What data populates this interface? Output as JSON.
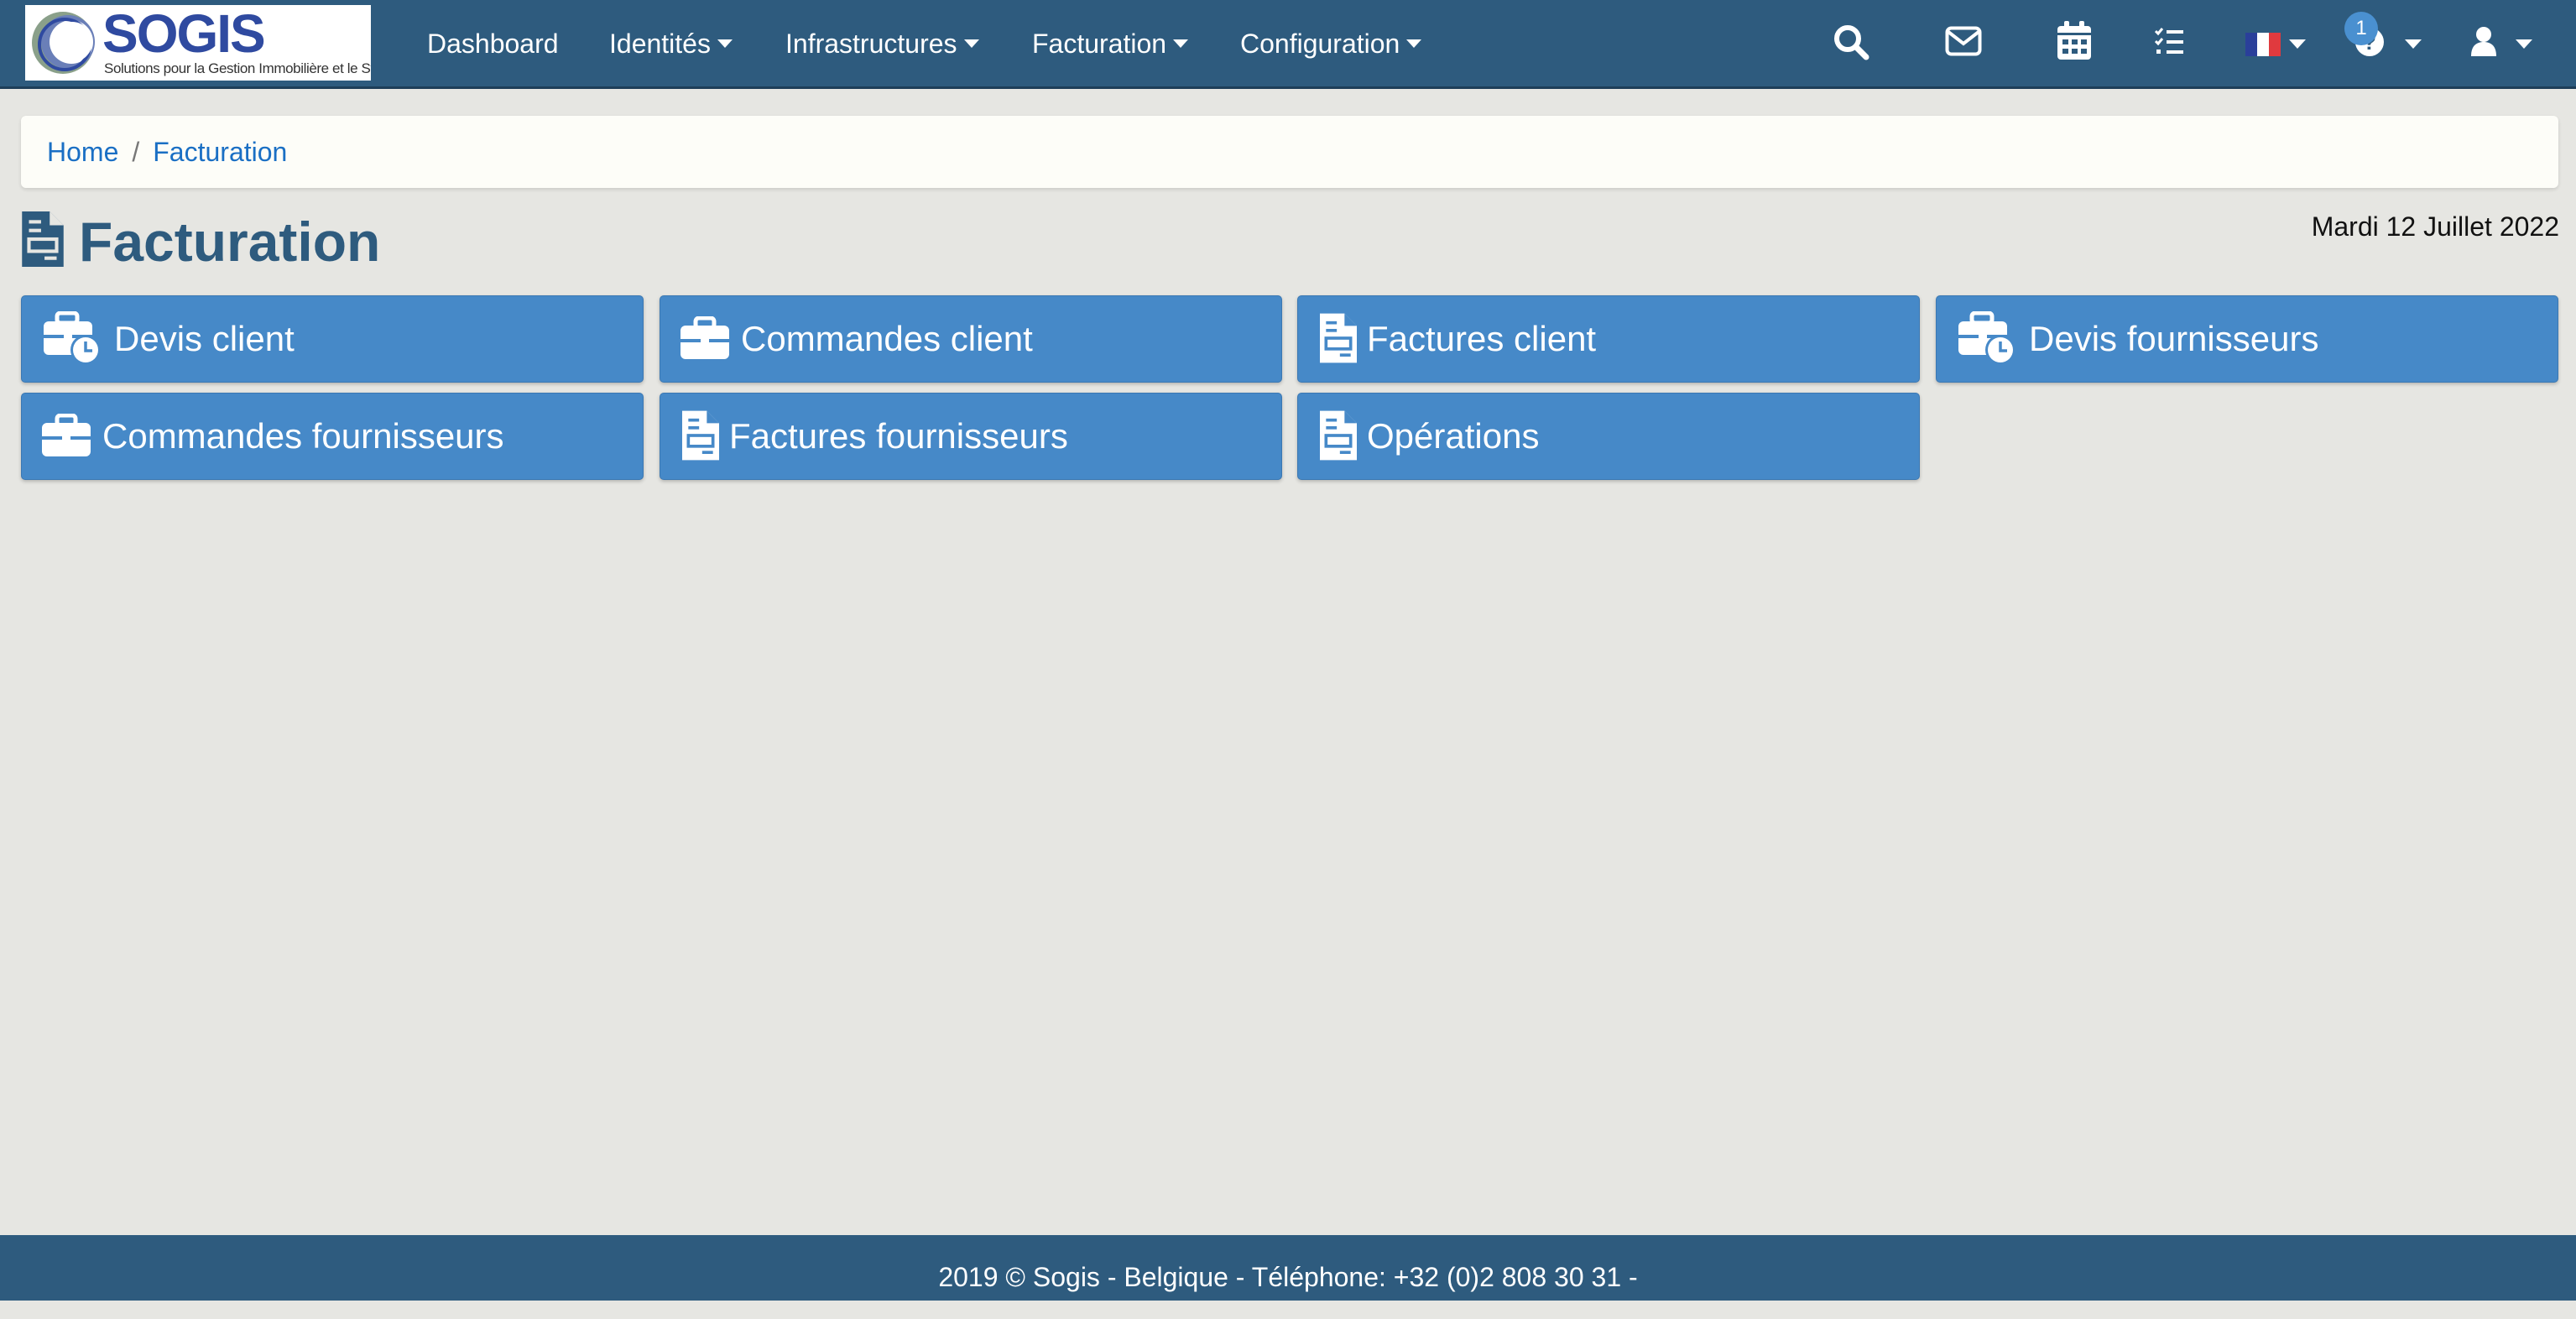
{
  "brand": {
    "name": "SOGIS",
    "tagline": "Solutions pour la Gestion Immobilière et le Syndic"
  },
  "nav": {
    "items": [
      {
        "label": "Dashboard",
        "dropdown": false
      },
      {
        "label": "Identités",
        "dropdown": true
      },
      {
        "label": "Infrastructures",
        "dropdown": true
      },
      {
        "label": "Facturation",
        "dropdown": true
      },
      {
        "label": "Configuration",
        "dropdown": true
      }
    ],
    "icons": [
      "search-icon",
      "mail-icon",
      "calendar-icon",
      "tasks-icon",
      "flag-fr-icon",
      "help-icon",
      "user-icon"
    ],
    "notification_count": "1"
  },
  "breadcrumb": {
    "home": "Home",
    "separator": "/",
    "current": "Facturation"
  },
  "page": {
    "title": "Facturation",
    "date": "Mardi 12 Juillet 2022"
  },
  "tiles": [
    {
      "label": "Devis client",
      "icon": "briefcase-clock-icon"
    },
    {
      "label": "Commandes client",
      "icon": "briefcase-icon"
    },
    {
      "label": "Factures client",
      "icon": "invoice-icon"
    },
    {
      "label": "Devis fournisseurs",
      "icon": "briefcase-clock-icon"
    },
    {
      "label": "Commandes fournisseurs",
      "icon": "briefcase-icon"
    },
    {
      "label": "Factures fournisseurs",
      "icon": "invoice-icon"
    },
    {
      "label": "Opérations",
      "icon": "invoice-icon"
    }
  ],
  "footer": {
    "text": "2019 © Sogis - Belgique - Téléphone: +32 (0)2 808 30 31 -"
  },
  "colors": {
    "navbar": "#2e5b7e",
    "tile": "#4689c8",
    "background": "#e6e6e2",
    "link": "#1a6fc4",
    "badge": "#4a90d0"
  }
}
